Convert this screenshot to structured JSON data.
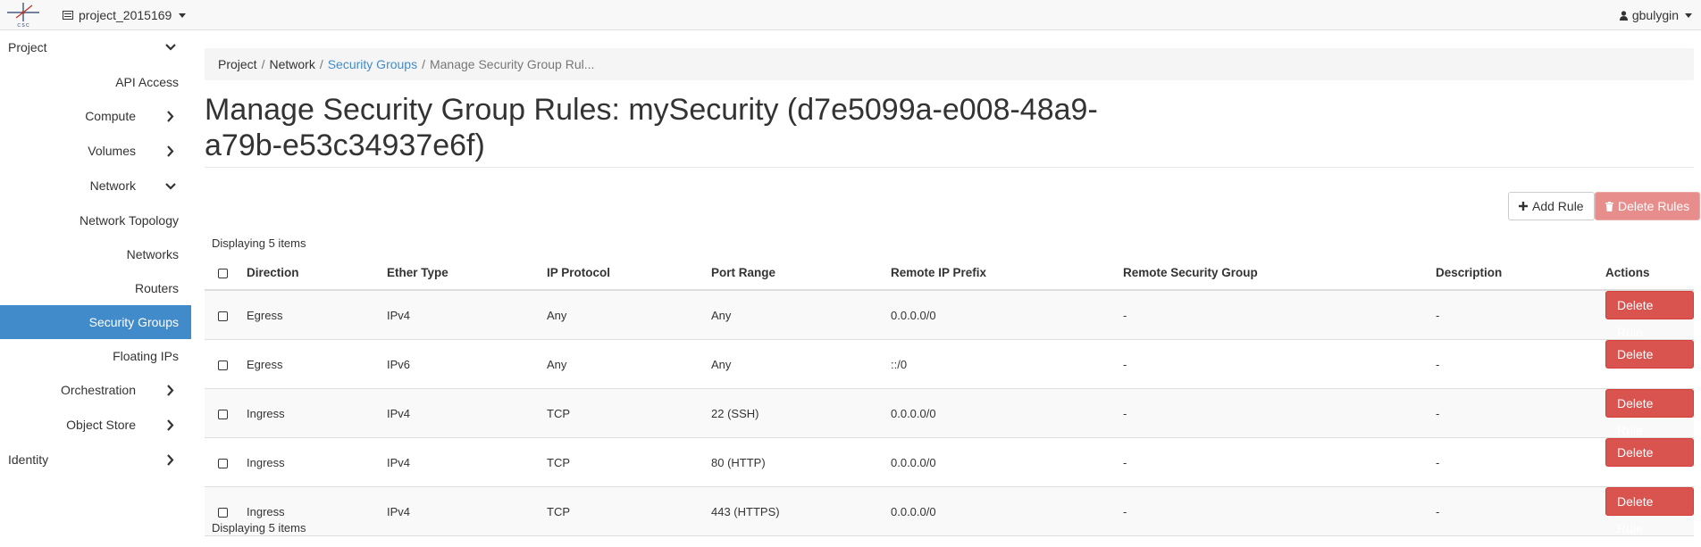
{
  "topbar": {
    "project_name": "project_2015169",
    "user_name": "gbulygin"
  },
  "sidebar": {
    "items": [
      {
        "label": "Project",
        "level": 1,
        "chevron": "chevron-down-icon"
      },
      {
        "label": "API Access",
        "level": 3
      },
      {
        "label": "Compute",
        "level": 2,
        "chevron": "chevron-right-icon"
      },
      {
        "label": "Volumes",
        "level": 2,
        "chevron": "chevron-right-icon"
      },
      {
        "label": "Network",
        "level": 2,
        "chevron": "chevron-down-icon"
      },
      {
        "label": "Network Topology",
        "level": 3
      },
      {
        "label": "Networks",
        "level": 3
      },
      {
        "label": "Routers",
        "level": 3
      },
      {
        "label": "Security Groups",
        "level": 3,
        "active": true
      },
      {
        "label": "Floating IPs",
        "level": 3
      },
      {
        "label": "Orchestration",
        "level": 2,
        "chevron": "chevron-right-icon"
      },
      {
        "label": "Object Store",
        "level": 2,
        "chevron": "chevron-right-icon"
      },
      {
        "label": "Identity",
        "level": 1,
        "chevron": "chevron-right-icon"
      }
    ],
    "active_color": "#428bca"
  },
  "breadcrumb": {
    "items": [
      "Project",
      "Network",
      "Security Groups",
      "Manage Security Group Rul..."
    ],
    "separator": "/"
  },
  "page": {
    "title": "Manage Security Group Rules: mySecurity (d7e5099a-e008-48a9-a79b-e53c34937e6f)",
    "count_top": "Displaying 5 items",
    "count_bottom": "Displaying 5 items"
  },
  "actions": {
    "add_rule": "Add Rule",
    "delete_rules": "Delete Rules"
  },
  "table": {
    "columns": [
      "Direction",
      "Ether Type",
      "IP Protocol",
      "Port Range",
      "Remote IP Prefix",
      "Remote Security Group",
      "Description",
      "Actions"
    ],
    "rows": [
      {
        "direction": "Egress",
        "ether_type": "IPv4",
        "ip_protocol": "Any",
        "port_range": "Any",
        "remote_ip_prefix": "0.0.0.0/0",
        "remote_security_group": "-",
        "description": "-",
        "action": "Delete Rule"
      },
      {
        "direction": "Egress",
        "ether_type": "IPv6",
        "ip_protocol": "Any",
        "port_range": "Any",
        "remote_ip_prefix": "::/0",
        "remote_security_group": "-",
        "description": "-",
        "action": "Delete Rule"
      },
      {
        "direction": "Ingress",
        "ether_type": "IPv4",
        "ip_protocol": "TCP",
        "port_range": "22 (SSH)",
        "remote_ip_prefix": "0.0.0.0/0",
        "remote_security_group": "-",
        "description": "-",
        "action": "Delete Rule"
      },
      {
        "direction": "Ingress",
        "ether_type": "IPv4",
        "ip_protocol": "TCP",
        "port_range": "80 (HTTP)",
        "remote_ip_prefix": "0.0.0.0/0",
        "remote_security_group": "-",
        "description": "-",
        "action": "Delete Rule"
      },
      {
        "direction": "Ingress",
        "ether_type": "IPv4",
        "ip_protocol": "TCP",
        "port_range": "443 (HTTPS)",
        "remote_ip_prefix": "0.0.0.0/0",
        "remote_security_group": "-",
        "description": "-",
        "action": "Delete Rule"
      }
    ]
  },
  "colors": {
    "danger": "#d9534f",
    "danger_disabled": "#e68987",
    "link": "#428bca"
  }
}
